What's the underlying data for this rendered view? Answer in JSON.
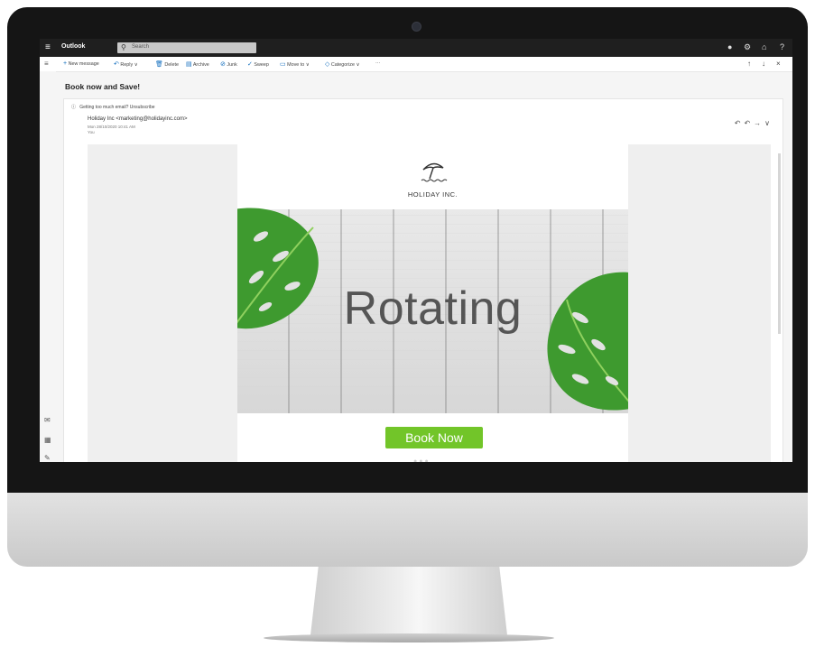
{
  "app": {
    "name": "Outlook",
    "search_placeholder": "Search"
  },
  "commands": {
    "new_message": "New message",
    "reply": "Reply",
    "delete": "Delete",
    "archive": "Archive",
    "junk": "Junk",
    "sweep": "Sweep",
    "move_to": "Move to",
    "categorize": "Categorize",
    "more": "···"
  },
  "message": {
    "subject": "Book now and Save!",
    "info_bar": "Getting too much email? Unsubscribe",
    "sender": "Holiday Inc <marketing@holidayinc.com>",
    "date": "Mon 28/10/2020 10:41 AM",
    "to": "You"
  },
  "email_body": {
    "logo_text": "HOLIDAY INC.",
    "hero_text": "Rotating",
    "cta_label": "Book Now",
    "dots": "●●●"
  },
  "colors": {
    "accent": "#0f6cbd",
    "cta": "#72c529",
    "leaf": "#3e9a2f"
  }
}
